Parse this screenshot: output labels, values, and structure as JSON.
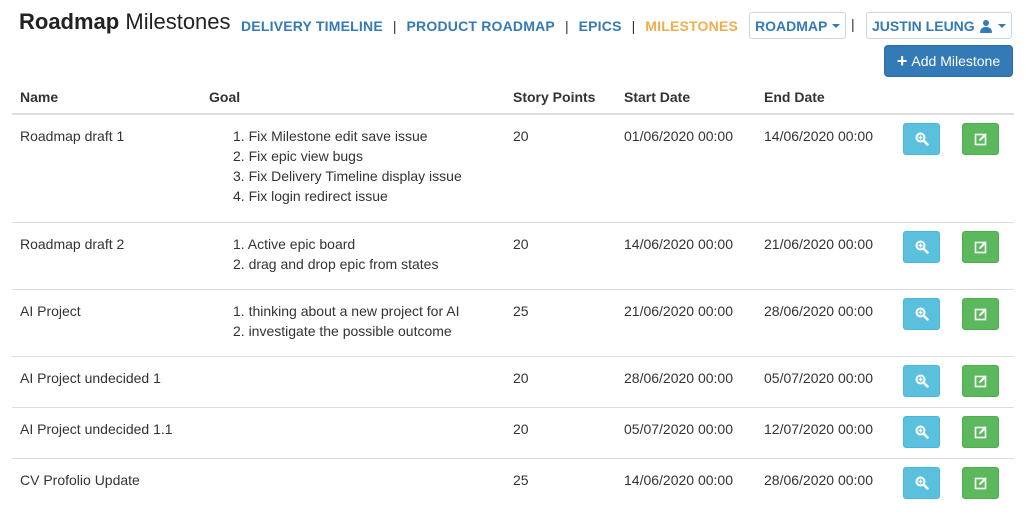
{
  "header": {
    "title_bold": "Roadmap",
    "title_rest": "Milestones",
    "nav": [
      {
        "label": "DELIVERY TIMELINE",
        "active": false
      },
      {
        "label": "PRODUCT ROADMAP",
        "active": false
      },
      {
        "label": "EPICS",
        "active": false
      },
      {
        "label": "MILESTONES",
        "active": true
      }
    ],
    "separator": "|",
    "roadmap_dropdown": "ROADMAP",
    "user_dropdown": "JUSTIN LEUNG",
    "add_button": "Add Milestone"
  },
  "table": {
    "columns": [
      "Name",
      "Goal",
      "Story Points",
      "Start Date",
      "End Date"
    ],
    "rows": [
      {
        "name": "Roadmap draft 1",
        "goals": [
          "1. Fix Milestone edit save issue",
          "2. Fix epic view bugs",
          "3. Fix Delivery Timeline display issue",
          "4. Fix login redirect issue"
        ],
        "points": "20",
        "start": "01/06/2020 00:00",
        "end": "14/06/2020 00:00"
      },
      {
        "name": "Roadmap draft 2",
        "goals": [
          "1. Active epic board",
          "2. drag and drop epic from states"
        ],
        "points": "20",
        "start": "14/06/2020 00:00",
        "end": "21/06/2020 00:00"
      },
      {
        "name": "AI Project",
        "goals": [
          "1. thinking about a new project for AI",
          "2. investigate the possible outcome"
        ],
        "points": "25",
        "start": "21/06/2020 00:00",
        "end": "28/06/2020 00:00"
      },
      {
        "name": "AI Project undecided 1",
        "goals": [],
        "points": "20",
        "start": "28/06/2020 00:00",
        "end": "05/07/2020 00:00"
      },
      {
        "name": "AI Project undecided 1.1",
        "goals": [],
        "points": "20",
        "start": "05/07/2020 00:00",
        "end": "12/07/2020 00:00"
      },
      {
        "name": "CV Profolio Update",
        "goals": [],
        "points": "25",
        "start": "14/06/2020 00:00",
        "end": "28/06/2020 00:00"
      }
    ],
    "row_actions": {
      "view_icon": "zoom-in-icon",
      "edit_icon": "edit-icon"
    }
  },
  "colors": {
    "link": "#337ab7",
    "active_link": "#f0ad4e",
    "primary": "#337ab7",
    "info": "#5bc0de",
    "success": "#5cb85c"
  }
}
